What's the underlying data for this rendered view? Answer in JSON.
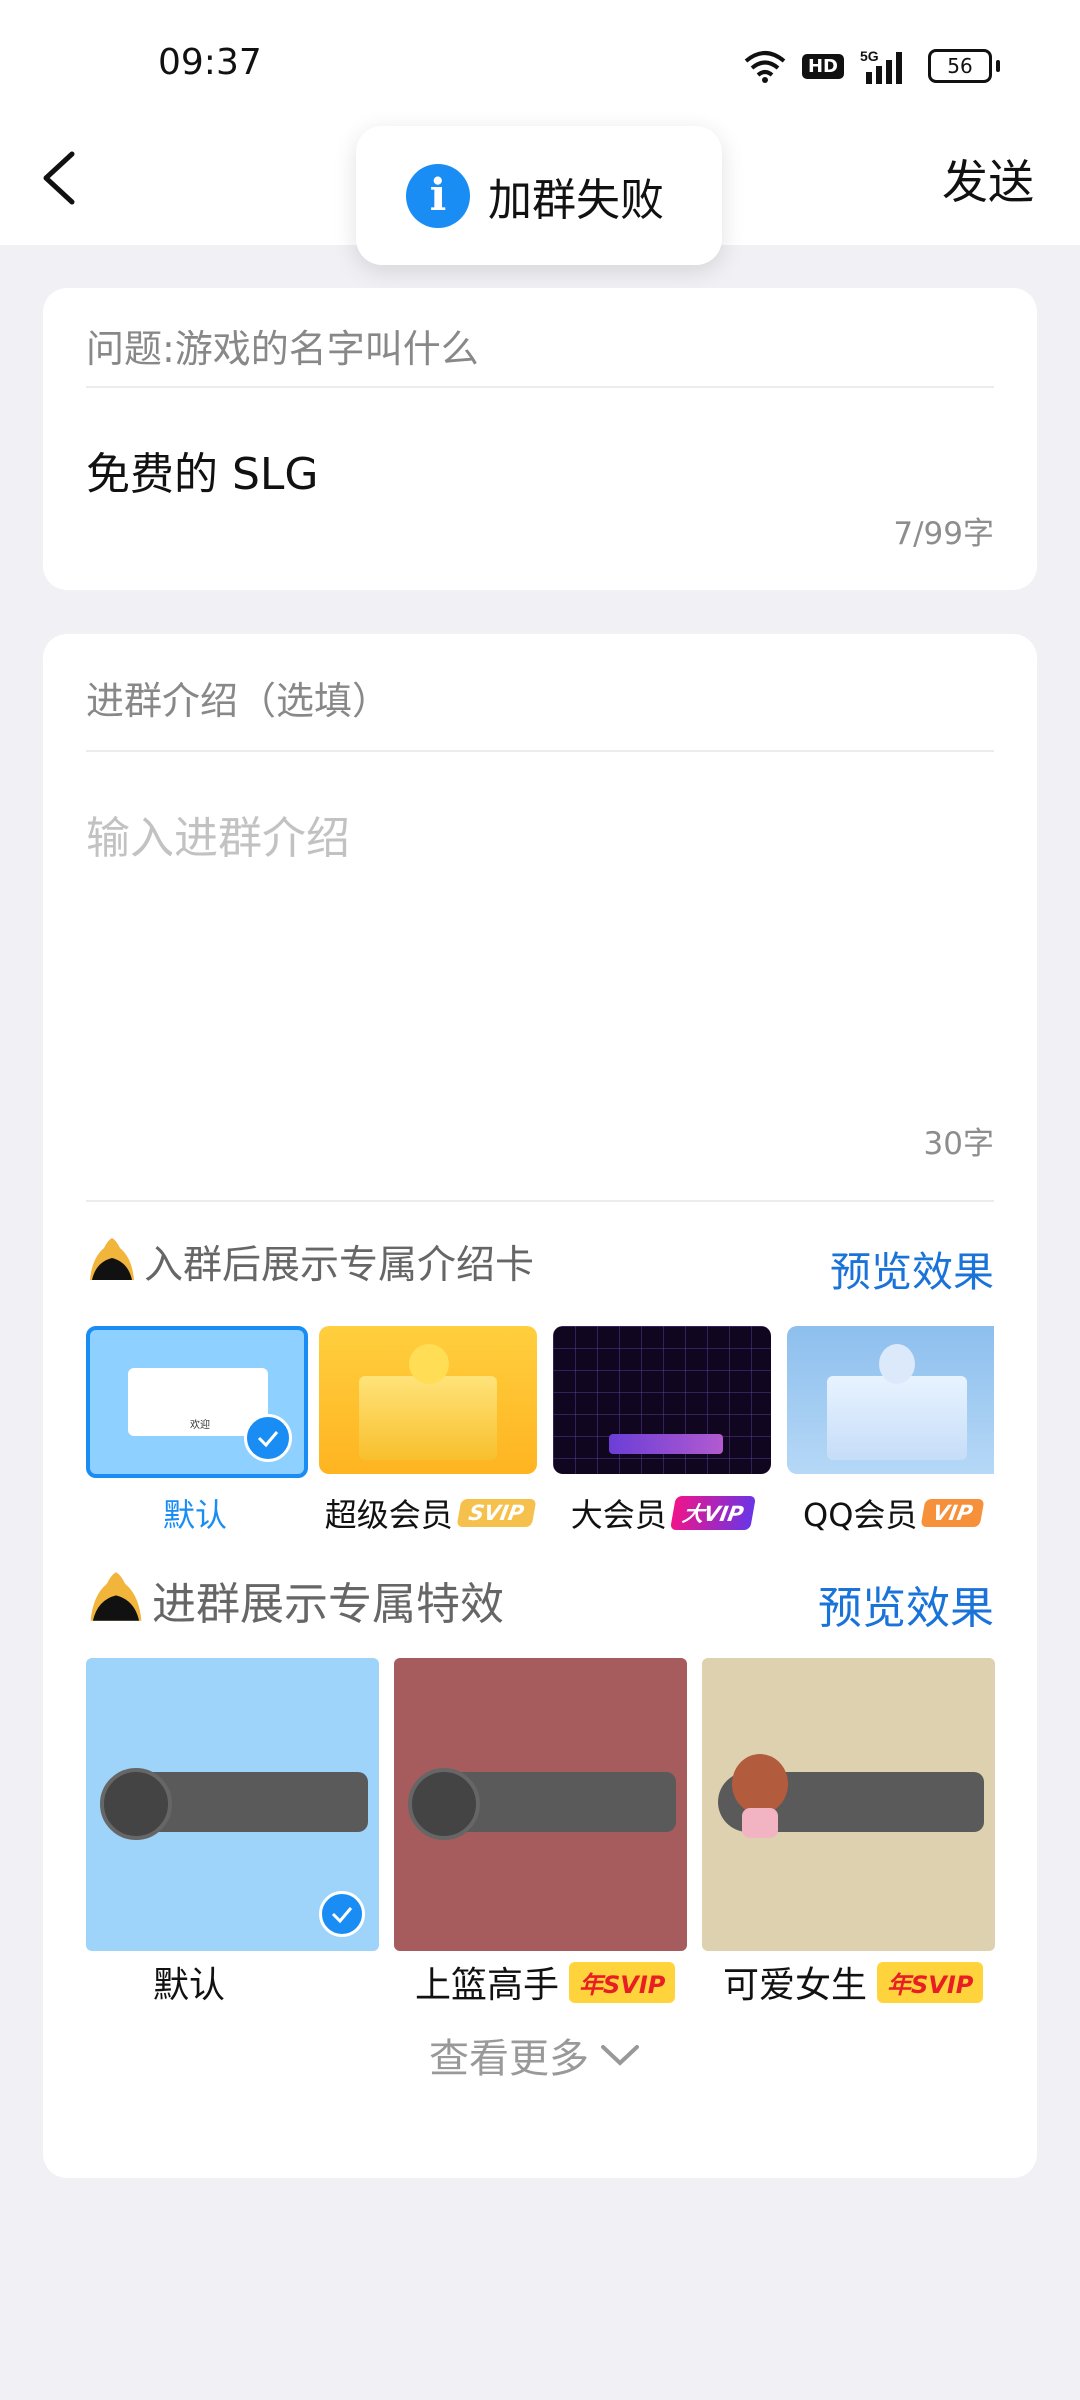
{
  "status_bar": {
    "time": "09:37",
    "network": "5G",
    "hd": "HD",
    "battery": "56"
  },
  "nav": {
    "send_label": "发送"
  },
  "toast": {
    "text": "加群失败"
  },
  "question": {
    "label": "问题:游戏的名字叫什么",
    "answer": "免费的 SLG",
    "counter": "7/99字"
  },
  "intro": {
    "label": "进群介绍（选填）",
    "placeholder": "输入进群介绍",
    "counter": "30字"
  },
  "intro_card_section": {
    "title": "入群后展示专属介绍卡",
    "preview": "预览效果",
    "cards": [
      {
        "label": "默认",
        "selected": true,
        "tag": ""
      },
      {
        "label": "超级会员",
        "tag": "SVIP"
      },
      {
        "label": "大会员",
        "tag": "大VIP"
      },
      {
        "label": "QQ会员",
        "tag": "VIP"
      }
    ],
    "card_text": "欢迎"
  },
  "effect_section": {
    "title": "进群展示专属特效",
    "preview": "预览效果",
    "effects": [
      {
        "label": "默认",
        "tag": "",
        "selected": true
      },
      {
        "label": "上篮高手",
        "tag": "年SVIP"
      },
      {
        "label": "可爱女生",
        "tag": "年SVIP"
      }
    ]
  },
  "more": {
    "label": "查看更多"
  },
  "colors": {
    "accent": "#1a8df5",
    "link": "#1a73d9",
    "background": "#f1f1f5"
  }
}
